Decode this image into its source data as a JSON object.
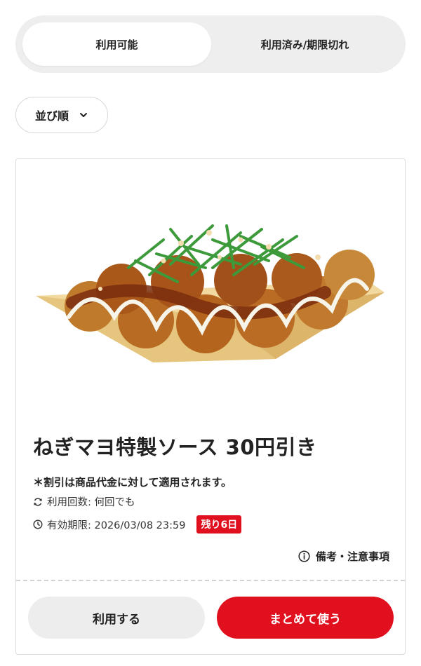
{
  "tabs": {
    "available": "利用可能",
    "used_expired": "利用済み/期限切れ"
  },
  "sort": {
    "label": "並び順"
  },
  "coupon": {
    "title": "ねぎマヨ特製ソース 30円引き",
    "note": "＊割引は商品代金に対して適用されます。",
    "usage_label": "利用回数: 何回でも",
    "expiry_label": "有効期限: 2026/03/08 23:59",
    "remaining_badge": "残り6日",
    "remarks_label": "備考・注意事項",
    "use_button": "利用する",
    "bulk_button": "まとめて使う"
  },
  "colors": {
    "accent_red": "#e0101e",
    "tab_bg": "#eeeeee",
    "secondary_button_bg": "#ededed"
  },
  "icons": [
    "chevron-down-icon",
    "repeat-icon",
    "clock-icon",
    "info-icon"
  ]
}
